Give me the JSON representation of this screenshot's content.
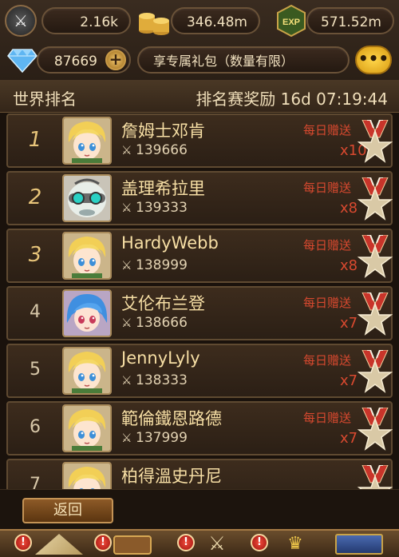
{
  "top": {
    "power_value": "2.16k",
    "gold_value": "346.48m",
    "exp_value": "571.52m",
    "exp_badge": "EXP",
    "gems_value": "87669",
    "promo_text": "享专属礼包（数量有限）",
    "chat_glyph": "•••"
  },
  "ranking": {
    "title": "世界排名",
    "reward_label": "排名赛奖励 16d 07:19:44"
  },
  "rows": [
    {
      "rank": "1",
      "name": "詹姆士邓肯",
      "power": "139666",
      "daily": "每日赠送",
      "count": "x10",
      "avatar": "blonde"
    },
    {
      "rank": "2",
      "name": "盖理希拉里",
      "power": "139333",
      "daily": "每日赠送",
      "count": "x8",
      "avatar": "robot"
    },
    {
      "rank": "3",
      "name": "HardyWebb",
      "power": "138999",
      "daily": "每日赠送",
      "count": "x8",
      "avatar": "blonde"
    },
    {
      "rank": "4",
      "name": "艾伦布兰登",
      "power": "138666",
      "daily": "每日赠送",
      "count": "x7",
      "avatar": "bluehair"
    },
    {
      "rank": "5",
      "name": "JennyLyly",
      "power": "138333",
      "daily": "每日赠送",
      "count": "x7",
      "avatar": "blonde"
    },
    {
      "rank": "6",
      "name": "範倫鐵恩路德",
      "power": "137999",
      "daily": "每日赠送",
      "count": "x7",
      "avatar": "blonde"
    },
    {
      "rank": "7",
      "name": "柏得溫史丹尼",
      "power": "",
      "daily": "",
      "count": "",
      "avatar": "blonde"
    }
  ],
  "footer": {
    "back_label": "返回"
  },
  "colors": {
    "accent_gold": "#f7dfa5",
    "reward_red": "#d8492f",
    "panel_brown": "#3d2c1d"
  }
}
